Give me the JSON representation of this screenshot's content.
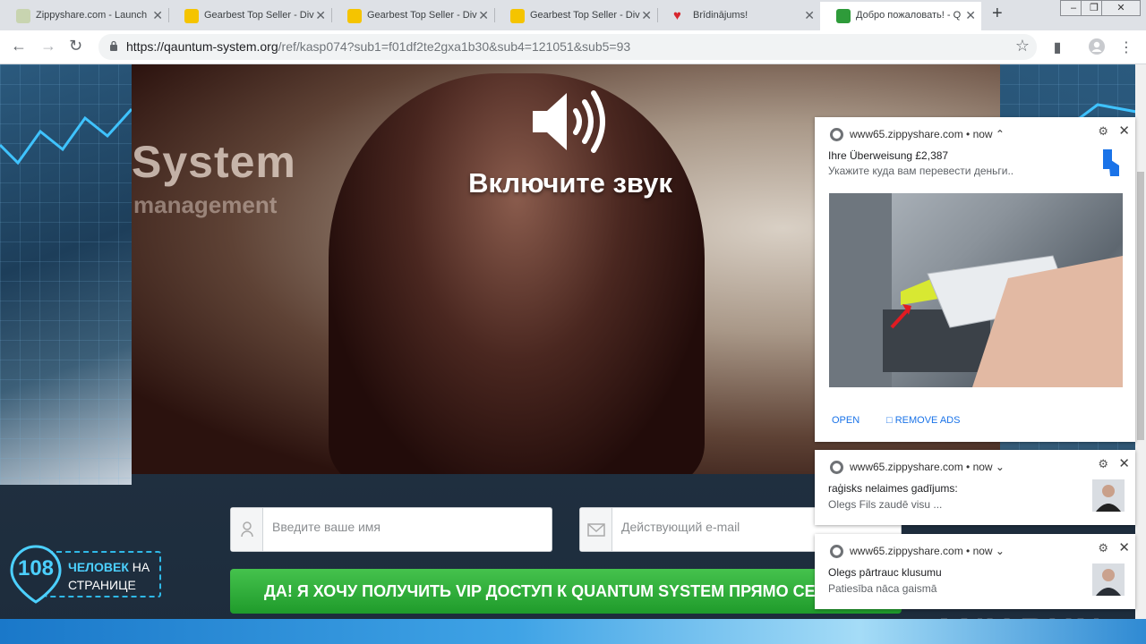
{
  "browser": {
    "tabs": [
      {
        "title": "Zippyshare.com - Launch",
        "favicon_color": "#c8d4b0",
        "active": false
      },
      {
        "title": "Gearbest Top Seller - Div",
        "favicon_color": "#f5c400",
        "active": false
      },
      {
        "title": "Gearbest Top Seller - Div",
        "favicon_color": "#f5c400",
        "active": false
      },
      {
        "title": "Gearbest Top Seller - Div",
        "favicon_color": "#f5c400",
        "active": false
      },
      {
        "title": "Brīdinājums!",
        "favicon_color": "#d7262e",
        "active": false
      },
      {
        "title": "Добро пожаловать! - Q",
        "favicon_color": "#2e9b3a",
        "active": true
      }
    ],
    "url_host": "https://qauntum-system.org",
    "url_path": "/ref/kasp074?sub1=f01df2te2gxa1b30&sub4=121051&sub5=93"
  },
  "hero": {
    "brand": "System",
    "brand_sub": "management",
    "sound_prompt": "Включите звук",
    "sound_icon": "speaker-volume-icon"
  },
  "form": {
    "name_placeholder": "Введите ваше имя",
    "email_placeholder": "Действующий e-mail",
    "cta_label": "ДА! Я ХОЧУ ПОЛУЧИТЬ VIP ДОСТУП К QUANTUM SYSTEM ПРЯМО СЕЙЧАС!"
  },
  "counter": {
    "number": "108",
    "label_bold": "ЧЕЛОВЕК",
    "label_rest": " НА СТРАНИЦЕ"
  },
  "notifications": [
    {
      "origin": "www65.zippyshare.com • now ⌃",
      "title": "Ihre Überweisung £2,387",
      "body": "Укажите куда вам перевести деньги..",
      "open_label": "OPEN",
      "remove_label": "REMOVE ADS"
    },
    {
      "origin": "www65.zippyshare.com • now ⌄",
      "title": "raģisks nelaimes gadījums:",
      "body": "Olegs Fils zaudē visu ..."
    },
    {
      "origin": "www65.zippyshare.com • now ⌄",
      "title": "Olegs pārtrauc klusumu",
      "body": "Patiesība nāca gaismā"
    }
  ],
  "watermark": "ANY.RUN",
  "colors": {
    "cta_green": "#2aab35",
    "counter_blue": "#4cd0ff",
    "link_blue": "#1a73e8"
  }
}
